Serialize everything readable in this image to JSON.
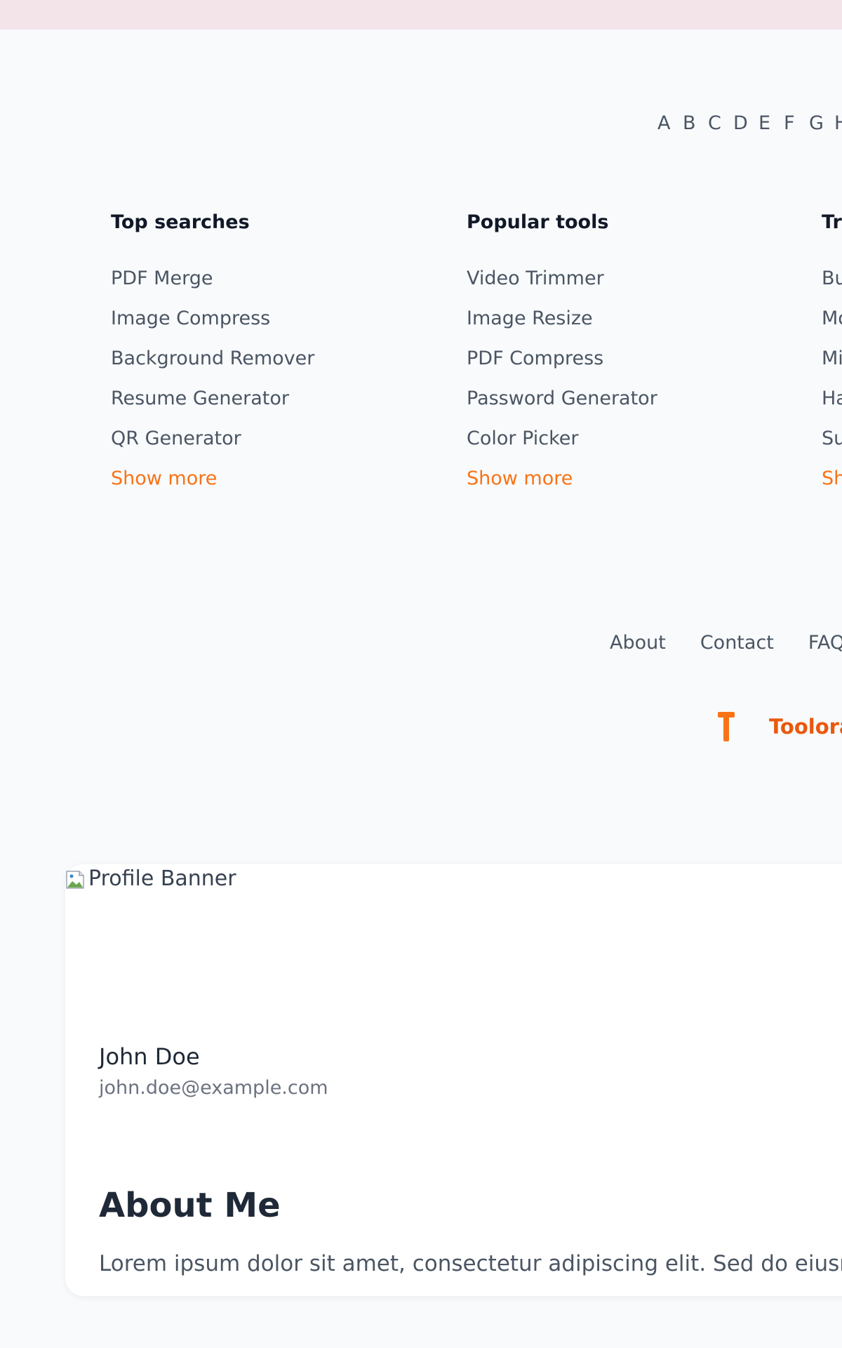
{
  "alphabet": [
    "A",
    "B",
    "C",
    "D",
    "E",
    "F",
    "G",
    "H"
  ],
  "columns": [
    {
      "title": "Top searches",
      "items": [
        "PDF Merge",
        "Image Compress",
        "Background Remover",
        "Resume Generator",
        "QR Generator"
      ],
      "more": "Show more"
    },
    {
      "title": "Popular tools",
      "items": [
        "Video Trimmer",
        "Image Resize",
        "PDF Compress",
        "Password Generator",
        "Color Picker"
      ],
      "more": "Show more"
    },
    {
      "title": "Tr",
      "items": [
        "Bu",
        "Mo",
        "Mi",
        "Ha",
        "Su"
      ],
      "more": "Sh"
    }
  ],
  "footer": {
    "links": [
      "About",
      "Contact",
      "FAQ"
    ],
    "brand_name": "Toolora",
    "brand_icon": "tool-icon"
  },
  "profile": {
    "banner_alt": "Profile Banner",
    "name": "John Doe",
    "email": "john.doe@example.com",
    "about_title": "About Me",
    "about_text": "Lorem ipsum dolor sit amet, consectetur adipiscing elit. Sed do eiusm"
  },
  "colors": {
    "accent": "#f97316",
    "brand": "#ea580c",
    "top_strip": "#f3e4ea"
  }
}
